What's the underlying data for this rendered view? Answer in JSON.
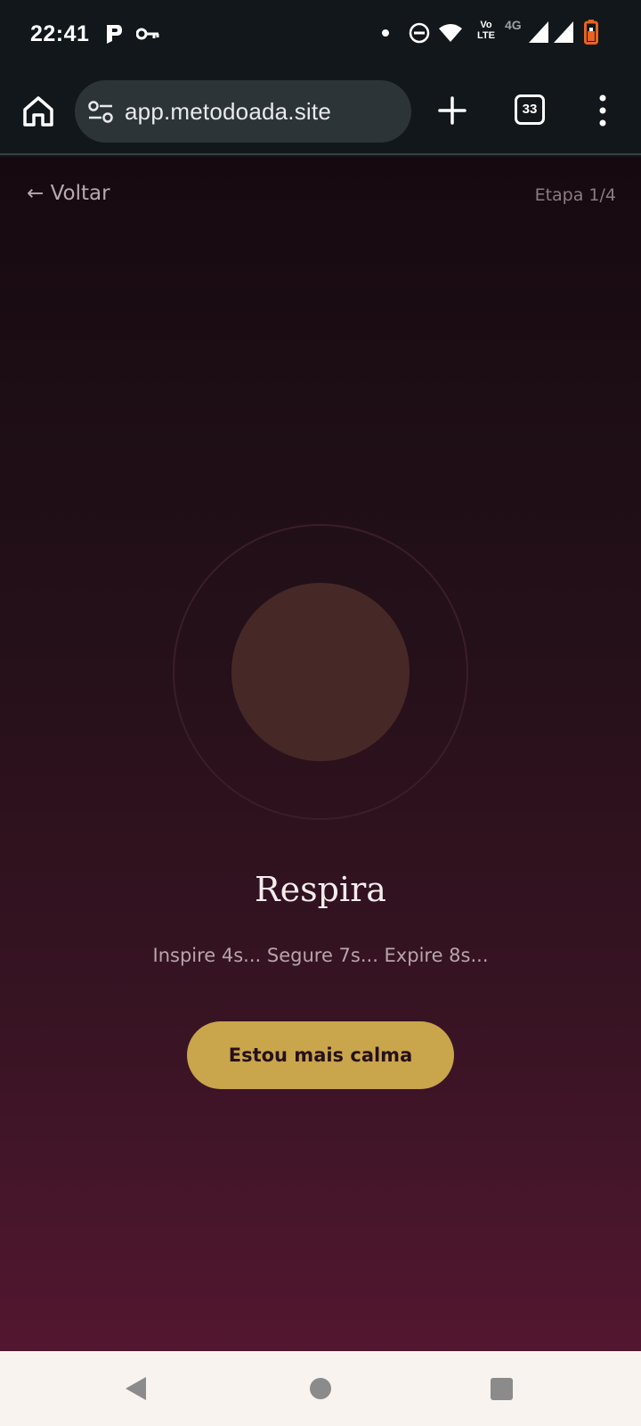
{
  "status_bar": {
    "time": "22:41",
    "network": "4G",
    "volte_top": "Vo",
    "volte_bottom": "LTE",
    "icons": [
      "parking-icon",
      "key-icon",
      "notification-dot-icon",
      "dnd-icon",
      "wifi-icon",
      "volte-icon",
      "signal-icon",
      "signal-icon",
      "battery-icon"
    ]
  },
  "browser": {
    "url": "app.metodoada.site",
    "tab_count": "33",
    "icons": [
      "home-icon",
      "tune-icon",
      "plus-icon",
      "tabs-icon",
      "more-vert-icon"
    ]
  },
  "page": {
    "back_label": "← Voltar",
    "step_label": "Etapa 1/4",
    "title": "Respira",
    "instructions": "Inspire 4s... Segure 7s... Expire 8s...",
    "cta_label": "Estou mais calma"
  },
  "colors": {
    "accent": "#c9a54c",
    "orb": "#462926",
    "background_top": "#160a10",
    "background_bottom": "#531730"
  },
  "nav_bar": {
    "icons": [
      "back-triangle-icon",
      "home-circle-icon",
      "recents-square-icon"
    ]
  }
}
